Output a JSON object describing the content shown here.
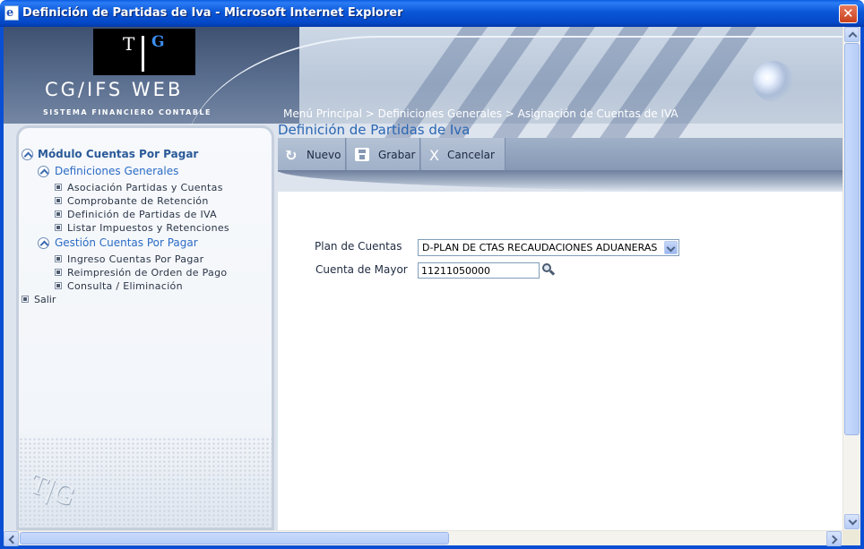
{
  "window": {
    "title": "Definición de Partidas de Iva - Microsoft Internet Explorer",
    "app_icon": "ie-page-icon",
    "close_glyph": "✕"
  },
  "banner": {
    "logo_t": "T",
    "logo_g": "G",
    "app_name": "CG/IFS WEB",
    "app_subtitle": "SISTEMA FINANCIERO CONTABLE",
    "breadcrumb": "Menú Principal > Definiciones Generales > Asignación de Cuentas de IVA"
  },
  "sidebar": {
    "module_label": "Módulo Cuentas Por Pagar",
    "groups": [
      {
        "label": "Definiciones Generales",
        "items": [
          "Asociación Partidas y Cuentas",
          "Comprobante de Retención",
          "Definición de Partidas de IVA",
          "Listar Impuestos y Retenciones"
        ]
      },
      {
        "label": "Gestión Cuentas Por Pagar",
        "items": [
          "Ingreso Cuentas Por Pagar",
          "Reimpresión de Orden de Pago",
          "Consulta / Eliminación"
        ]
      }
    ],
    "exit_label": "Salir"
  },
  "content": {
    "title": "Definición de Partidas de Iva",
    "toolbar": {
      "new_label": "Nuevo",
      "save_label": "Grabar",
      "cancel_label": "Cancelar",
      "new_icon": "refresh-icon",
      "save_icon": "floppy-disk-icon",
      "cancel_icon": "x-icon",
      "cancel_glyph": "X"
    },
    "form": {
      "plan_label": "Plan de Cuentas",
      "plan_value": "D-PLAN DE CTAS RECAUDACIONES ADUANERAS",
      "cuenta_label": "Cuenta de Mayor",
      "cuenta_value": "11211050000",
      "search_icon": "magnifier-icon"
    }
  },
  "colors": {
    "titlebar": "#0a5ae0",
    "link_blue": "#2a66b3",
    "toolbar": "#8597b3"
  }
}
